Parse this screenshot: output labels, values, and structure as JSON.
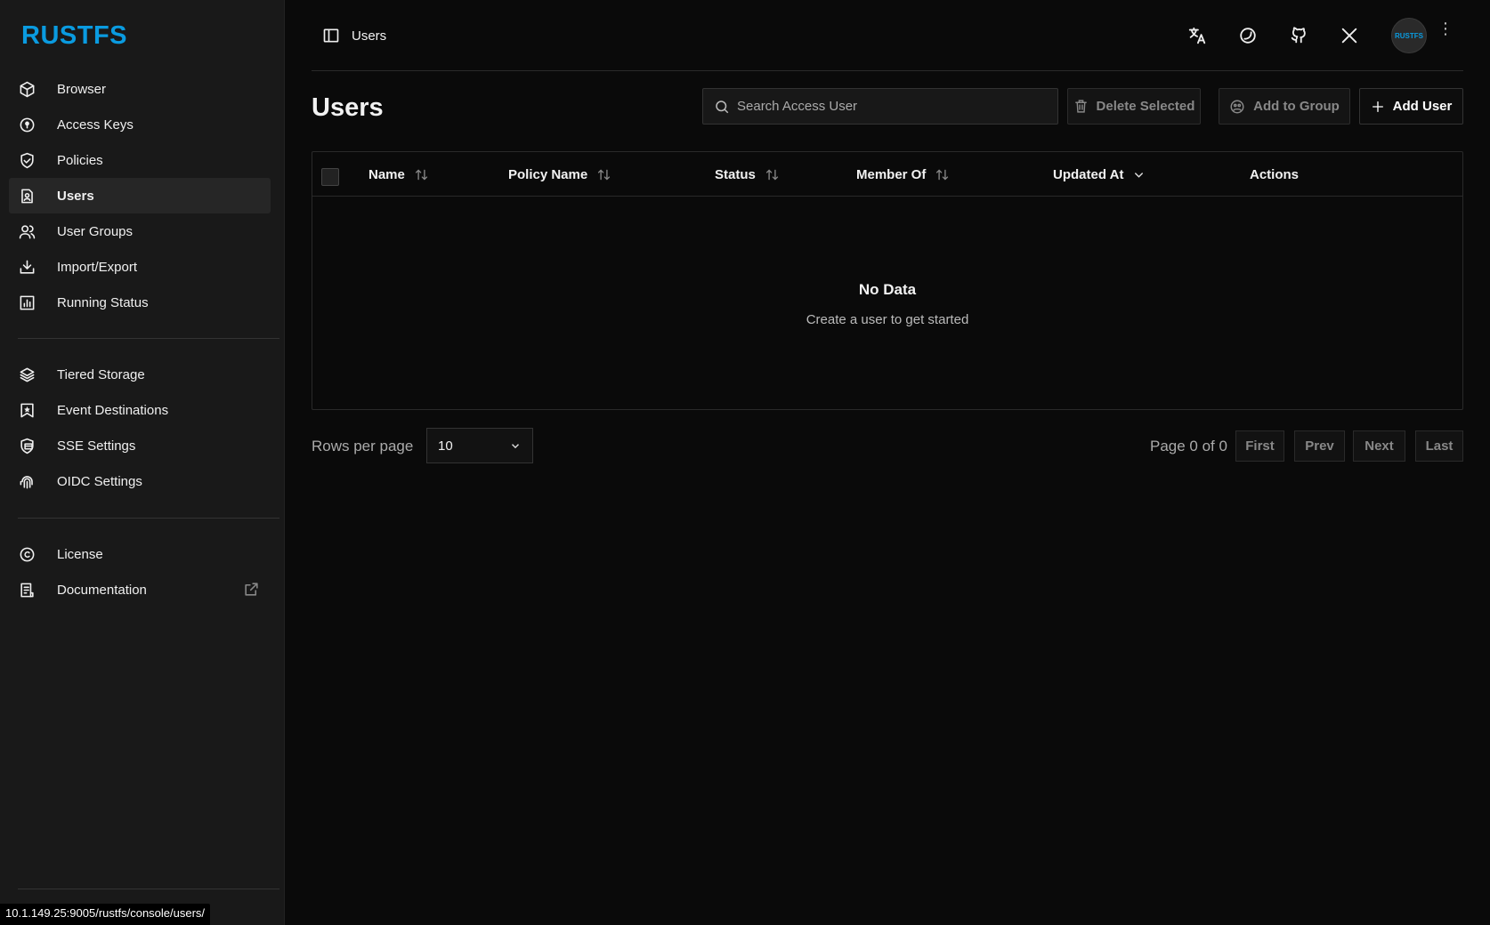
{
  "brand": {
    "logo": "RUSTFS",
    "color": "#0a9be0",
    "avatar_text": "RUSTFS"
  },
  "sidebar": {
    "primary": [
      {
        "label": "Browser",
        "icon": "box-icon"
      },
      {
        "label": "Access Keys",
        "icon": "key-circle-icon"
      },
      {
        "label": "Policies",
        "icon": "shield-check-icon"
      },
      {
        "label": "Users",
        "icon": "user-file-icon",
        "active": true
      },
      {
        "label": "User Groups",
        "icon": "users-icon"
      },
      {
        "label": "Import/Export",
        "icon": "download-icon"
      },
      {
        "label": "Running Status",
        "icon": "bar-chart-icon"
      }
    ],
    "secondary": [
      {
        "label": "Tiered Storage",
        "icon": "layers-icon"
      },
      {
        "label": "Event Destinations",
        "icon": "bookmark-star-icon"
      },
      {
        "label": "SSE Settings",
        "icon": "shield-lock-icon"
      },
      {
        "label": "OIDC Settings",
        "icon": "fingerprint-icon"
      }
    ],
    "footer": [
      {
        "label": "License",
        "icon": "copyright-icon"
      },
      {
        "label": "Documentation",
        "icon": "document-icon"
      }
    ]
  },
  "status_url": "10.1.149.25:9005/rustfs/console/users/",
  "header": {
    "breadcrumb": "Users"
  },
  "page": {
    "title": "Users",
    "search_placeholder": "Search Access User",
    "delete_selected": "Delete Selected",
    "add_to_group": "Add to Group",
    "add_user": "Add User"
  },
  "table": {
    "columns": [
      "Name",
      "Policy Name",
      "Status",
      "Member Of",
      "Updated At",
      "Actions"
    ],
    "empty_title": "No Data",
    "empty_subtitle": "Create a user to get started"
  },
  "pagination": {
    "rows_per_page_label": "Rows per page",
    "rows_per_page": "10",
    "page_info": "Page 0 of 0",
    "first": "First",
    "prev": "Prev",
    "next": "Next",
    "last": "Last"
  }
}
